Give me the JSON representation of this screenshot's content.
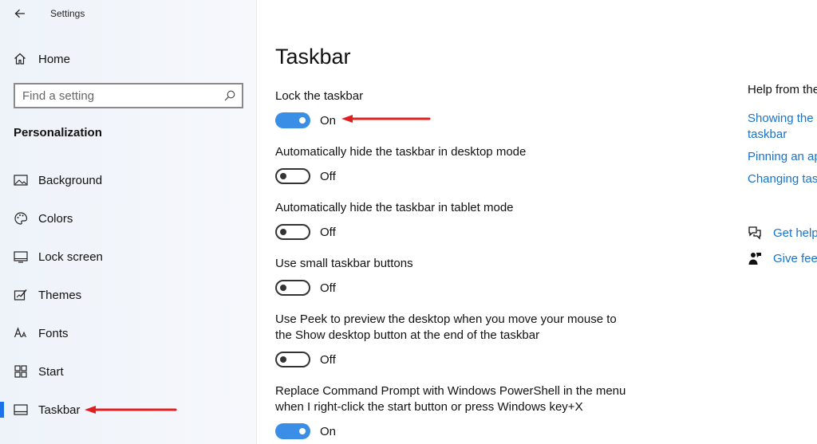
{
  "window": {
    "title": "Settings"
  },
  "sidebar": {
    "home_label": "Home",
    "search_placeholder": "Find a setting",
    "section_title": "Personalization",
    "items": [
      {
        "label": "Background",
        "icon": "image-icon"
      },
      {
        "label": "Colors",
        "icon": "palette-icon"
      },
      {
        "label": "Lock screen",
        "icon": "lock-screen-icon"
      },
      {
        "label": "Themes",
        "icon": "themes-icon"
      },
      {
        "label": "Fonts",
        "icon": "fonts-icon"
      },
      {
        "label": "Start",
        "icon": "start-icon"
      },
      {
        "label": "Taskbar",
        "icon": "taskbar-icon",
        "selected": true
      }
    ]
  },
  "main": {
    "title": "Taskbar",
    "settings": [
      {
        "label": "Lock the taskbar",
        "state": "On",
        "on": true
      },
      {
        "label": "Automatically hide the taskbar in desktop mode",
        "state": "Off",
        "on": false
      },
      {
        "label": "Automatically hide the taskbar in tablet mode",
        "state": "Off",
        "on": false
      },
      {
        "label": "Use small taskbar buttons",
        "state": "Off",
        "on": false
      },
      {
        "label_line1": "Use Peek to preview the desktop when you move your mouse to",
        "label_line2": "the Show desktop button at the end of the taskbar",
        "state": "Off",
        "on": false
      },
      {
        "label_line1": "Replace Command Prompt with Windows PowerShell in the menu",
        "label_line2": "when I right-click the start button or press Windows key+X",
        "state": "On",
        "on": true
      }
    ]
  },
  "help": {
    "title": "Help from the",
    "links": [
      {
        "line1": "Showing the",
        "line2": "taskbar"
      },
      {
        "line1": "Pinning an ap"
      },
      {
        "line1": "Changing tas"
      }
    ],
    "get_help": "Get help",
    "give_feedback": "Give fee"
  },
  "colors": {
    "accent": "#3a8ee6",
    "link": "#1a73c8",
    "annotation_arrow": "#e02020"
  }
}
